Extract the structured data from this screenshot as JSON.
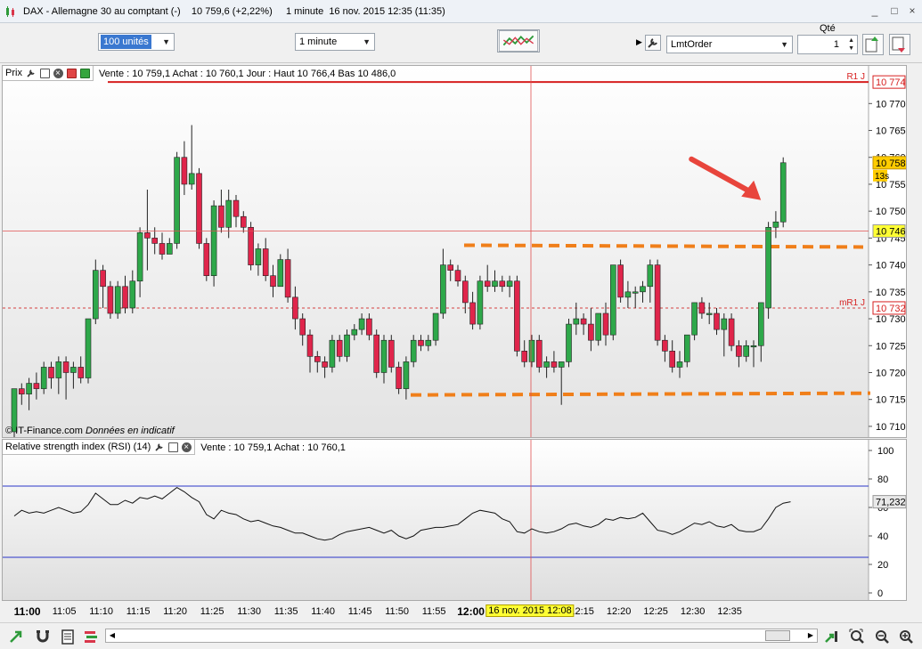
{
  "window": {
    "title": "DAX - Allemagne 30 au comptant (-)    10 759,6 (+2,22%)     1 minute  16 nov. 2015 12:35 (11:35)",
    "controls": [
      "_",
      "□",
      "×"
    ]
  },
  "toolbar": {
    "units_value": "100 unités",
    "timeframe_value": "1 minute",
    "order_type_value": "LmtOrder",
    "qty_label": "Qté",
    "qty_value": "1"
  },
  "price_panel": {
    "name": "Prix",
    "info": "Vente : 10 759,1 Achat : 10 760,1 Jour : Haut 10 766,4 Bas 10 486,0",
    "watermark_brand": "© IT-Finance.com",
    "watermark_note": "Données en indicatif",
    "axis_labels": [
      "10 770",
      "10 765",
      "10 760",
      "10 755",
      "10 750",
      "10 745",
      "10 740",
      "10 735",
      "10 730",
      "10 725",
      "10 720",
      "10 715",
      "10 710"
    ],
    "r1_label": "R1 J",
    "r1_value": "10 774",
    "mr1_label": "mR1 J",
    "mr1_value": "10 732",
    "last_price": "10 758,6",
    "countdown": "13s",
    "cursor_price": "10 746,3"
  },
  "rsi_panel": {
    "name": "Relative strength index (RSI) (14)",
    "info": "Vente : 10 759,1 Achat : 10 760,1",
    "axis_labels": [
      "100",
      "80",
      "60",
      "40",
      "20",
      "0"
    ],
    "last_value": "71,232"
  },
  "time_axis": {
    "labels": [
      "11:00",
      "11:05",
      "11:10",
      "11:15",
      "11:20",
      "11:25",
      "11:30",
      "11:35",
      "11:40",
      "11:45",
      "11:50",
      "11:55",
      "12:00",
      "12:15",
      "12:20",
      "12:25",
      "12:30",
      "12:35"
    ],
    "cursor_date": "16 nov. 2015 12:08"
  },
  "chart_data": {
    "type": "candlestick",
    "timeframe": "1 minute",
    "x_start": "10:58",
    "ylim": [
      10708,
      10777
    ],
    "resistance_R1": 10774,
    "mid_resistance_mR1": 10732,
    "crosshair": {
      "time": "12:08",
      "price": 10746.3
    },
    "range_box": {
      "top": 10743.5,
      "bottom": 10716
    },
    "candles": [
      [
        10709,
        10717,
        10708,
        10717
      ],
      [
        10717,
        10718,
        10714,
        10716
      ],
      [
        10716,
        10719,
        10713,
        10718
      ],
      [
        10718,
        10720,
        10715,
        10717
      ],
      [
        10717,
        10722,
        10716,
        10721
      ],
      [
        10721,
        10722,
        10717,
        10719
      ],
      [
        10719,
        10723,
        10716,
        10722
      ],
      [
        10722,
        10723,
        10715,
        10720
      ],
      [
        10720,
        10722,
        10717,
        10721
      ],
      [
        10721,
        10723,
        10718,
        10719
      ],
      [
        10719,
        10730,
        10718,
        10730
      ],
      [
        10730,
        10741,
        10729,
        10739
      ],
      [
        10739,
        10740,
        10732,
        10736
      ],
      [
        10736,
        10737,
        10730,
        10731
      ],
      [
        10731,
        10737,
        10730,
        10736
      ],
      [
        10736,
        10738,
        10731,
        10732
      ],
      [
        10732,
        10739,
        10731,
        10737
      ],
      [
        10737,
        10747,
        10734,
        10746
      ],
      [
        10746,
        10754,
        10739,
        10745
      ],
      [
        10745,
        10747,
        10742,
        10744
      ],
      [
        10744,
        10746,
        10741,
        10742
      ],
      [
        10742,
        10745,
        10742,
        10744
      ],
      [
        10744,
        10761,
        10743,
        10760
      ],
      [
        10760,
        10763,
        10753,
        10755
      ],
      [
        10755,
        10766,
        10754,
        10757
      ],
      [
        10757,
        10758,
        10743,
        10744
      ],
      [
        10744,
        10745,
        10737,
        10738
      ],
      [
        10738,
        10752,
        10736,
        10751
      ],
      [
        10751,
        10754,
        10746,
        10747
      ],
      [
        10747,
        10754,
        10745,
        10752
      ],
      [
        10752,
        10753,
        10747,
        10749
      ],
      [
        10749,
        10750,
        10746,
        10747
      ],
      [
        10747,
        10748,
        10739,
        10740
      ],
      [
        10740,
        10744,
        10738,
        10743
      ],
      [
        10743,
        10745,
        10737,
        10738
      ],
      [
        10738,
        10740,
        10734,
        10736
      ],
      [
        10736,
        10742,
        10736,
        10741
      ],
      [
        10741,
        10743,
        10733,
        10734
      ],
      [
        10734,
        10736,
        10728,
        10730
      ],
      [
        10730,
        10731,
        10725,
        10727
      ],
      [
        10727,
        10728,
        10720,
        10723
      ],
      [
        10723,
        10724,
        10720,
        10722
      ],
      [
        10722,
        10723,
        10719,
        10721
      ],
      [
        10721,
        10727,
        10720,
        10726
      ],
      [
        10726,
        10727,
        10722,
        10723
      ],
      [
        10723,
        10728,
        10722,
        10727
      ],
      [
        10727,
        10729,
        10726,
        10728
      ],
      [
        10728,
        10731,
        10727,
        10730
      ],
      [
        10730,
        10731,
        10726,
        10727
      ],
      [
        10727,
        10728,
        10719,
        10720
      ],
      [
        10720,
        10727,
        10718,
        10726
      ],
      [
        10726,
        10727,
        10720,
        10721
      ],
      [
        10721,
        10722,
        10716,
        10717
      ],
      [
        10717,
        10723,
        10715,
        10722
      ],
      [
        10722,
        10727,
        10721,
        10726
      ],
      [
        10726,
        10727,
        10724,
        10725
      ],
      [
        10725,
        10727,
        10724,
        10726
      ],
      [
        10726,
        10731,
        10725,
        10731
      ],
      [
        10731,
        10743,
        10730,
        10740
      ],
      [
        10740,
        10741,
        10737,
        10739
      ],
      [
        10739,
        10740,
        10736,
        10737
      ],
      [
        10737,
        10738,
        10731,
        10733
      ],
      [
        10733,
        10735,
        10728,
        10729
      ],
      [
        10729,
        10738,
        10728,
        10737
      ],
      [
        10737,
        10740,
        10735,
        10736
      ],
      [
        10736,
        10739,
        10735,
        10737
      ],
      [
        10737,
        10738,
        10735,
        10736
      ],
      [
        10736,
        10738,
        10734,
        10737
      ],
      [
        10737,
        10738,
        10723,
        10724
      ],
      [
        10724,
        10726,
        10721,
        10722
      ],
      [
        10722,
        10727,
        10721,
        10726
      ],
      [
        10726,
        10727,
        10720,
        10721
      ],
      [
        10721,
        10723,
        10719,
        10722
      ],
      [
        10722,
        10724,
        10720,
        10721
      ],
      [
        10721,
        10722,
        10714,
        10722
      ],
      [
        10722,
        10730,
        10721,
        10729
      ],
      [
        10729,
        10733,
        10727,
        10730
      ],
      [
        10730,
        10731,
        10727,
        10729
      ],
      [
        10729,
        10732,
        10724,
        10726
      ],
      [
        10726,
        10731,
        10725,
        10731
      ],
      [
        10731,
        10733,
        10725,
        10727
      ],
      [
        10727,
        10740,
        10726,
        10740
      ],
      [
        10740,
        10741,
        10733,
        10734
      ],
      [
        10734,
        10737,
        10732,
        10735
      ],
      [
        10735,
        10736,
        10732,
        10735
      ],
      [
        10735,
        10737,
        10733,
        10736
      ],
      [
        10736,
        10741,
        10733,
        10740
      ],
      [
        10740,
        10741,
        10725,
        10726
      ],
      [
        10726,
        10727,
        10722,
        10724
      ],
      [
        10724,
        10726,
        10720,
        10721
      ],
      [
        10721,
        10724,
        10719,
        10722
      ],
      [
        10722,
        10727,
        10721,
        10727
      ],
      [
        10727,
        10733,
        10726,
        10733
      ],
      [
        10733,
        10734,
        10730,
        10731
      ],
      [
        10731,
        10733,
        10729,
        10731
      ],
      [
        10731,
        10732,
        10727,
        10728
      ],
      [
        10728,
        10731,
        10723,
        10730
      ],
      [
        10730,
        10731,
        10724,
        10725
      ],
      [
        10725,
        10726,
        10721,
        10723
      ],
      [
        10723,
        10726,
        10722,
        10725
      ],
      [
        10725,
        10726,
        10721,
        10725
      ],
      [
        10725,
        10733,
        10722,
        10733
      ],
      [
        10732,
        10748,
        10730,
        10747
      ],
      [
        10747,
        10750,
        10745,
        10748
      ],
      [
        10748,
        10760,
        10747,
        10759
      ]
    ],
    "rsi": {
      "name": "RSI (14)",
      "levels": [
        25,
        75
      ],
      "ylim": [
        0,
        100
      ],
      "values": [
        54,
        58,
        56,
        57,
        56,
        58,
        60,
        58,
        56,
        57,
        62,
        70,
        66,
        62,
        62,
        65,
        63,
        67,
        66,
        68,
        66,
        70,
        74,
        71,
        67,
        64,
        55,
        52,
        58,
        56,
        55,
        52,
        50,
        51,
        49,
        47,
        46,
        44,
        42,
        42,
        40,
        38,
        37,
        38,
        41,
        43,
        44,
        45,
        46,
        44,
        42,
        44,
        40,
        38,
        40,
        44,
        45,
        46,
        46,
        47,
        48,
        52,
        56,
        58,
        57,
        56,
        52,
        50,
        43,
        42,
        45,
        43,
        42,
        43,
        45,
        48,
        49,
        47,
        46,
        48,
        52,
        51,
        53,
        52,
        53,
        56,
        50,
        44,
        43,
        41,
        43,
        46,
        49,
        48,
        50,
        47,
        46,
        48,
        44,
        43,
        43,
        45,
        52,
        60,
        63,
        64
      ]
    }
  }
}
